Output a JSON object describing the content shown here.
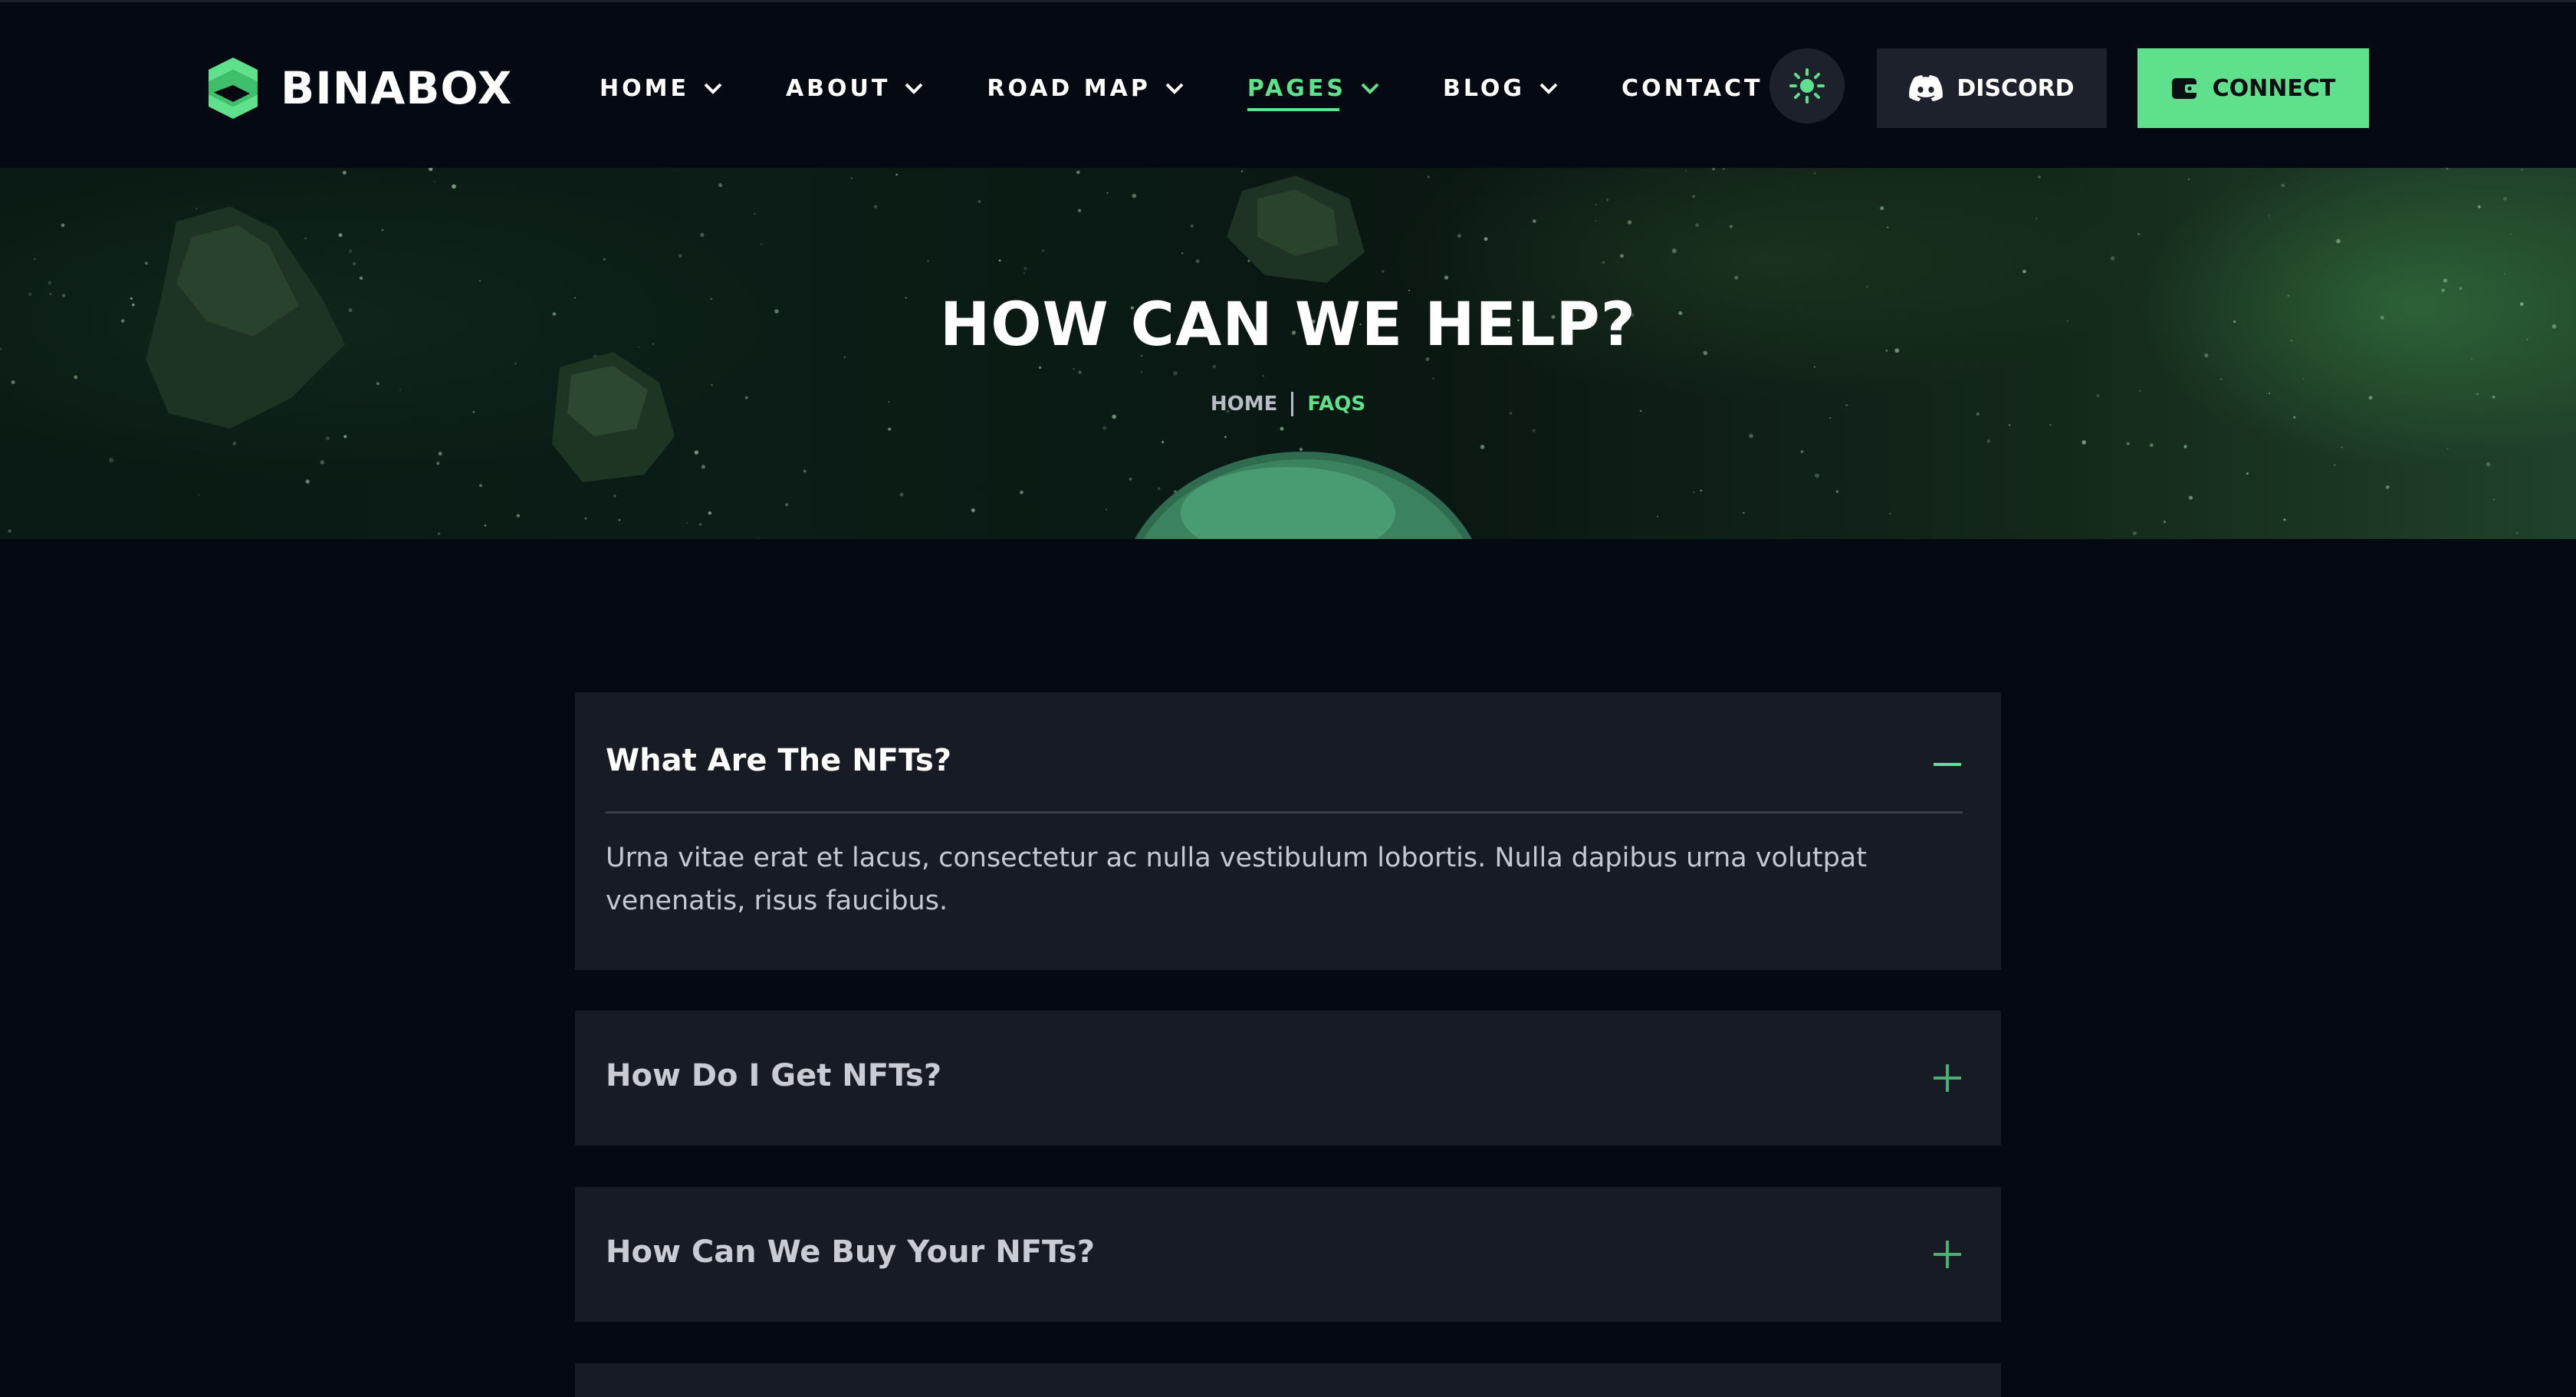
{
  "brand": {
    "name": "BINABOX",
    "accent": "#5ee08c",
    "background": "#050912"
  },
  "nav": {
    "items": [
      {
        "label": "HOME",
        "dropdown": true,
        "active": false
      },
      {
        "label": "ABOUT",
        "dropdown": true,
        "active": false
      },
      {
        "label": "ROAD MAP",
        "dropdown": true,
        "active": false
      },
      {
        "label": "PAGES",
        "dropdown": true,
        "active": true
      },
      {
        "label": "BLOG",
        "dropdown": true,
        "active": false
      },
      {
        "label": "CONTACT",
        "dropdown": false,
        "active": false
      }
    ]
  },
  "actions": {
    "theme_icon": "sun-icon",
    "discord_label": "DISCORD",
    "discord_icon": "discord-icon",
    "connect_label": "CONNECT",
    "connect_icon": "wallet-icon"
  },
  "hero": {
    "title": "HOW CAN WE HELP?",
    "breadcrumb": {
      "home": "HOME",
      "current": "FAQS"
    }
  },
  "faqs": [
    {
      "question": "What Are The NFTs?",
      "answer": "Urna vitae erat et lacus, consectetur ac nulla vestibulum lobortis. Nulla dapibus urna volutpat venenatis, risus faucibus.",
      "expanded": true
    },
    {
      "question": "How Do I Get NFTs?",
      "expanded": false
    },
    {
      "question": "How Can We Buy Your NFTs?",
      "expanded": false
    }
  ]
}
